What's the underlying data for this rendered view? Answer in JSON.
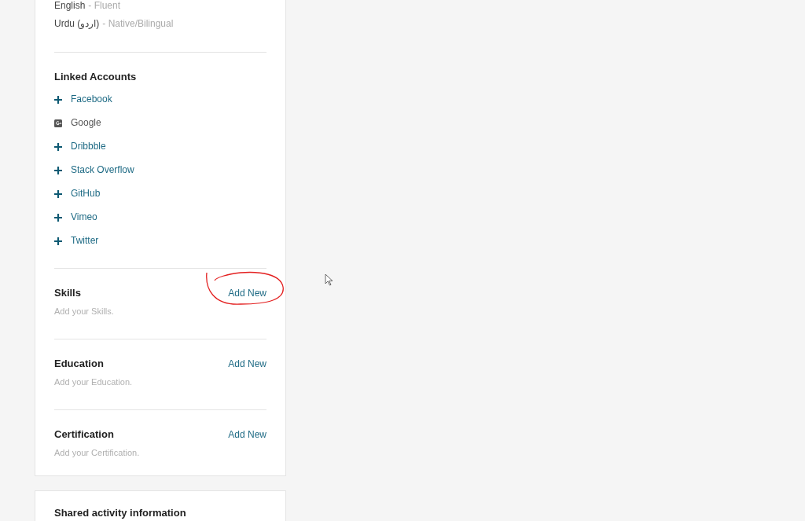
{
  "languages": [
    {
      "name": "English",
      "level": "- Fluent"
    },
    {
      "name": "Urdu (اردو)",
      "level": "- Native/Bilingual"
    }
  ],
  "linked_accounts": {
    "title": "Linked Accounts",
    "items": [
      {
        "label": "Facebook",
        "kind": "add"
      },
      {
        "label": "Google",
        "kind": "linked"
      },
      {
        "label": "Dribbble",
        "kind": "add"
      },
      {
        "label": "Stack Overflow",
        "kind": "add"
      },
      {
        "label": "GitHub",
        "kind": "add"
      },
      {
        "label": "Vimeo",
        "kind": "add"
      },
      {
        "label": "Twitter",
        "kind": "add"
      }
    ]
  },
  "sections": [
    {
      "title": "Skills",
      "action": "Add New",
      "hint": "Add your Skills.",
      "annotated": true
    },
    {
      "title": "Education",
      "action": "Add New",
      "hint": "Add your Education.",
      "annotated": false
    },
    {
      "title": "Certification",
      "action": "Add New",
      "hint": "Add your Certification.",
      "annotated": false
    }
  ],
  "shared_activity": {
    "title": "Shared activity information"
  }
}
